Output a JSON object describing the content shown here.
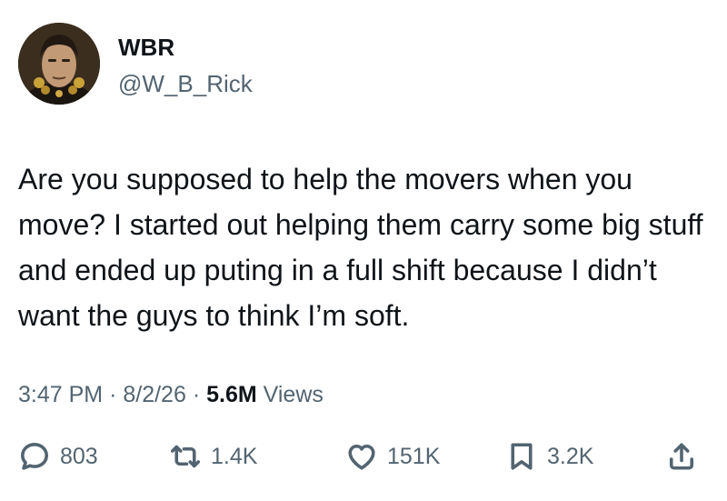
{
  "author": {
    "display_name": "WBR",
    "handle": "@W_B_Rick",
    "avatar_icon": "profile-photo"
  },
  "tweet": {
    "text": "Are you supposed to help the movers when you move? I started out helping them carry some big stuff and ended up puting in a full shift because I didn’t want the guys to think I’m soft.",
    "time": "3:47 PM",
    "date": "8/2/26",
    "separator": "·",
    "views_count": "5.6M",
    "views_label": "Views"
  },
  "actions": {
    "replies": "803",
    "retweets": "1.4K",
    "likes": "151K",
    "bookmarks": "3.2K",
    "icons": [
      "reply-icon",
      "retweet-icon",
      "like-icon",
      "bookmark-icon",
      "share-icon"
    ]
  },
  "colors": {
    "text": "#0f1419",
    "secondary": "#536471",
    "background": "#ffffff"
  }
}
